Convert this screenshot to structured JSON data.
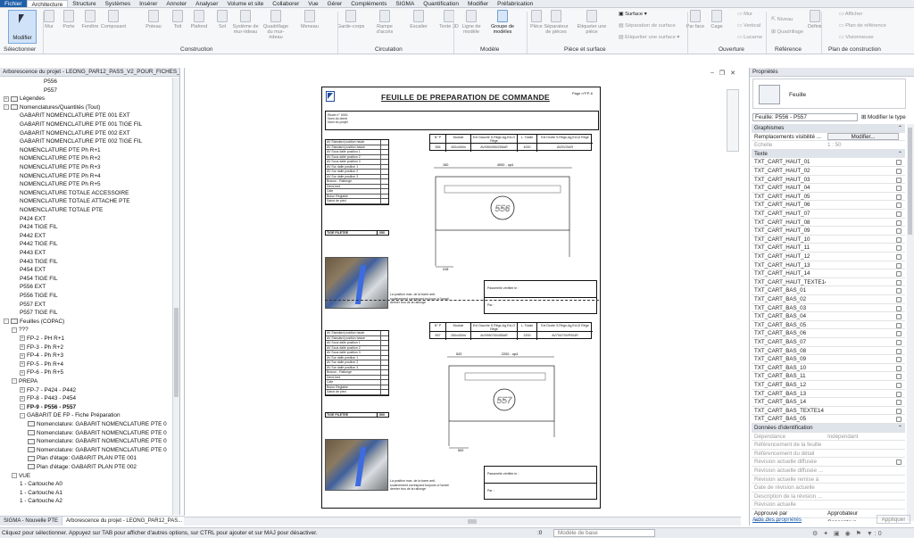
{
  "ribbon_tabs": [
    "Fichier",
    "Architecture",
    "Structure",
    "Systèmes",
    "Insérer",
    "Annoter",
    "Analyser",
    "Volume et site",
    "Collaborer",
    "Vue",
    "Gérer",
    "Compléments",
    "SIGMA",
    "Quantification",
    "Modifier",
    "Préfabrication"
  ],
  "ribbon": {
    "modifier": "Modifier",
    "tools": [
      {
        "label": "Mur"
      },
      {
        "label": "Porte"
      },
      {
        "label": "Fenêtre"
      },
      {
        "label": "Composant"
      },
      {
        "label": "Poteau"
      },
      {
        "label": "Toit"
      },
      {
        "label": "Plafond"
      },
      {
        "label": "Sol"
      },
      {
        "label": "Système de mur-rideau"
      },
      {
        "label": "Quadrillage du mur-rideau"
      },
      {
        "label": "Meneau"
      },
      {
        "label": "Garde-corps"
      },
      {
        "label": "Rampe d'accès"
      },
      {
        "label": "Escalier"
      },
      {
        "label": "Texte 3D"
      },
      {
        "label": "Ligne de modèle"
      },
      {
        "label": "Groupe de modèles"
      },
      {
        "label": "Pièce"
      },
      {
        "label": "Séparateur de pièces"
      },
      {
        "label": "Etiqueter une pièce"
      },
      {
        "label": "Par face"
      },
      {
        "label": "Cage"
      },
      {
        "label": "Définir"
      }
    ],
    "surface": "Surface",
    "sep_surface": "Séparation de surface",
    "etiq_surface": "Etiquetter une surface",
    "mur": "Mur",
    "vertical": "Vertical",
    "lucarne": "Lucarne",
    "niveau": "Niveau",
    "quadrillage": "Quadrillage",
    "afficher": "Afficher",
    "plan_ref": "Plan de référence",
    "visionneuse": "Visionneuse",
    "groups": [
      "Sélectionner",
      "Construction",
      "Circulation",
      "Modèle",
      "Pièce et surface",
      "Ouverture",
      "Référence",
      "Plan de construction"
    ]
  },
  "browser": {
    "title": "Arborescence du projet - LEONG_PAR12_PASS_V2_POUR_FICHES_PRE...",
    "items": [
      {
        "text": "P556",
        "lvl": 5,
        "toggle": ""
      },
      {
        "text": "P557",
        "lvl": 5,
        "toggle": ""
      },
      {
        "text": "Légendes",
        "lvl": 0,
        "toggle": "+",
        "icon": true
      },
      {
        "text": "Nomenclatures/Quantités (Tout)",
        "lvl": 0,
        "toggle": "-",
        "icon": true
      },
      {
        "text": "GABARIT NOMENCLATURE PTE 001 EXT",
        "lvl": 2,
        "toggle": ""
      },
      {
        "text": "GABARIT NOMENCLATURE PTE 001 TIGE FIL",
        "lvl": 2,
        "toggle": ""
      },
      {
        "text": "GABARIT NOMENCLATURE PTE 002 EXT",
        "lvl": 2,
        "toggle": ""
      },
      {
        "text": "GABARIT NOMENCLATURE PTE 002 TIGE FIL",
        "lvl": 2,
        "toggle": ""
      },
      {
        "text": "NOMENCLATURE PTE Ph R+1",
        "lvl": 2,
        "toggle": ""
      },
      {
        "text": "NOMENCLATURE PTE Ph R+2",
        "lvl": 2,
        "toggle": ""
      },
      {
        "text": "NOMENCLATURE PTE Ph R+3",
        "lvl": 2,
        "toggle": ""
      },
      {
        "text": "NOMENCLATURE PTE Ph R+4",
        "lvl": 2,
        "toggle": ""
      },
      {
        "text": "NOMENCLATURE PTE Ph R+5",
        "lvl": 2,
        "toggle": ""
      },
      {
        "text": "NOMENCLATURE TOTALE ACCESSOIRE",
        "lvl": 2,
        "toggle": ""
      },
      {
        "text": "NOMENCLATURE TOTALE ATTACHE PTE",
        "lvl": 2,
        "toggle": ""
      },
      {
        "text": "NOMENCLATURE TOTALE PTE",
        "lvl": 2,
        "toggle": ""
      },
      {
        "text": "P424 EXT",
        "lvl": 2,
        "toggle": ""
      },
      {
        "text": "P424 TIGE FIL",
        "lvl": 2,
        "toggle": ""
      },
      {
        "text": "P442 EXT",
        "lvl": 2,
        "toggle": ""
      },
      {
        "text": "P442 TIGE FIL",
        "lvl": 2,
        "toggle": ""
      },
      {
        "text": "P443 EXT",
        "lvl": 2,
        "toggle": ""
      },
      {
        "text": "P443 TIGE FIL",
        "lvl": 2,
        "toggle": ""
      },
      {
        "text": "P454 EXT",
        "lvl": 2,
        "toggle": ""
      },
      {
        "text": "P454 TIGE FIL",
        "lvl": 2,
        "toggle": ""
      },
      {
        "text": "P556 EXT",
        "lvl": 2,
        "toggle": ""
      },
      {
        "text": "P556 TIGE FIL",
        "lvl": 2,
        "toggle": ""
      },
      {
        "text": "P557 EXT",
        "lvl": 2,
        "toggle": ""
      },
      {
        "text": "P557 TIGE FIL",
        "lvl": 2,
        "toggle": ""
      },
      {
        "text": "Feuilles (COPAC)",
        "lvl": 0,
        "toggle": "-",
        "icon": true
      },
      {
        "text": "???",
        "lvl": 1,
        "toggle": "-"
      },
      {
        "text": "FP-2 - PH R+1",
        "lvl": 2,
        "toggle": "+"
      },
      {
        "text": "FP-3 - Ph R+2",
        "lvl": 2,
        "toggle": "+"
      },
      {
        "text": "FP-4 - Ph R+3",
        "lvl": 2,
        "toggle": "+"
      },
      {
        "text": "FP-5 - Ph R+4",
        "lvl": 2,
        "toggle": "+"
      },
      {
        "text": "FP-6 - Ph R+5",
        "lvl": 2,
        "toggle": "+"
      },
      {
        "text": "PREPA",
        "lvl": 1,
        "toggle": "-"
      },
      {
        "text": "FP-7 - P424 - P442",
        "lvl": 2,
        "toggle": "+"
      },
      {
        "text": "FP-8 - P443 - P454",
        "lvl": 2,
        "toggle": "+"
      },
      {
        "text": "FP-9 - P556 - P557",
        "lvl": 2,
        "toggle": "-",
        "bold": true
      },
      {
        "text": "GABARIT DE FP - Fiche Préparation",
        "lvl": 2,
        "toggle": "-"
      },
      {
        "text": "Nomenclature: GABARIT NOMENCLATURE PTE 0",
        "lvl": 3,
        "toggle": "",
        "icon": true
      },
      {
        "text": "Nomenclature: GABARIT NOMENCLATURE PTE 0",
        "lvl": 3,
        "toggle": "",
        "icon": true
      },
      {
        "text": "Nomenclature: GABARIT NOMENCLATURE PTE 0",
        "lvl": 3,
        "toggle": "",
        "icon": true
      },
      {
        "text": "Nomenclature: GABARIT NOMENCLATURE PTE 0",
        "lvl": 3,
        "toggle": "",
        "icon": true
      },
      {
        "text": "Plan d'étage: GABARIT PLAN PTE 001",
        "lvl": 3,
        "toggle": "",
        "icon": true
      },
      {
        "text": "Plan d'étage: GABARIT PLAN PTE 002",
        "lvl": 3,
        "toggle": "",
        "icon": true
      },
      {
        "text": "VUE",
        "lvl": 1,
        "toggle": "-"
      },
      {
        "text": "1 - Cartouche A0",
        "lvl": 2,
        "toggle": ""
      },
      {
        "text": "1 - Cartouche A1",
        "lvl": 2,
        "toggle": ""
      },
      {
        "text": "1 - Cartouche A2",
        "lvl": 2,
        "toggle": ""
      }
    ]
  },
  "bottom_tabs": [
    "SIGMA - Nouvelle PTE",
    "Arborescence du projet - LEONG_PAR12_PAS..."
  ],
  "sheet": {
    "title": "FEUILLE DE PREPARATION DE COMMANDE",
    "page": "Page n°FP-6",
    "header_lines": [
      "Etude n° 0001",
      "Nom du client",
      "Nom du projet"
    ],
    "left_rows": [
      "AV Standard position haute",
      "AV Standard position basse",
      "AV Sous dalle position 1",
      "AV Sous dalle position 2",
      "AV Sous dalle position 3",
      "AV Sur dalle position 1",
      "AV Sur dalle position 2",
      "AV Sur dalle position 3",
      "Bracon - Rallonge",
      "Demi-bed",
      "Cale",
      "Buton Reglable",
      "Sabot de pied"
    ],
    "tige": "TIGE FILETEE",
    "tige_values": [
      "050",
      "500"
    ],
    "table_headers": [
      "N° P",
      "Module",
      "Ext Gauche S.Rêge,Ag,Ext,G Rêge",
      "L. Totale",
      "Ext Droite S.Rêge,Ag,Ext,D Rêge"
    ],
    "rows": [
      [
        "556",
        "400x400m",
        "AV/050/050/255AR",
        "4000",
        "AVDV/DAR"
      ],
      [
        "557",
        "250x400m",
        "AV/095/700/455AR",
        "2200",
        "AV700/700/P004R"
      ]
    ],
    "note": "La position max. de la barre anti-soulevement correspond toujours à l'avant dernier trou de la rallonge",
    "box_labels": [
      "Passerelle vérifiée le :",
      "Par :"
    ],
    "marks": [
      "556",
      "557"
    ],
    "dims": [
      "4000 - up4",
      "2200 - up4",
      "150",
      "520",
      "418",
      "500"
    ]
  },
  "properties": {
    "title": "Propriétés",
    "type_name": "Feuille",
    "selector": "Feuille: P556 - P557",
    "modify_type": "Modifier le type",
    "rows": [
      {
        "k": "Graphismes",
        "cat": true
      },
      {
        "k": "Remplacements visibilité ...",
        "btn": "Modifier..."
      },
      {
        "k": "Echelle",
        "v": "1 : 50",
        "gray": true
      },
      {
        "k": "Texte",
        "cat": true
      },
      {
        "k": "TXT_CART_HAUT_01",
        "cb": true
      },
      {
        "k": "TXT_CART_HAUT_02",
        "cb": true
      },
      {
        "k": "TXT_CART_HAUT_03",
        "cb": true
      },
      {
        "k": "TXT_CART_HAUT_04",
        "cb": true
      },
      {
        "k": "TXT_CART_HAUT_05",
        "cb": true
      },
      {
        "k": "TXT_CART_HAUT_06",
        "cb": true
      },
      {
        "k": "TXT_CART_HAUT_07",
        "cb": true
      },
      {
        "k": "TXT_CART_HAUT_08",
        "cb": true
      },
      {
        "k": "TXT_CART_HAUT_09",
        "cb": true
      },
      {
        "k": "TXT_CART_HAUT_10",
        "cb": true
      },
      {
        "k": "TXT_CART_HAUT_11",
        "cb": true
      },
      {
        "k": "TXT_CART_HAUT_12",
        "cb": true
      },
      {
        "k": "TXT_CART_HAUT_13",
        "cb": true
      },
      {
        "k": "TXT_CART_HAUT_14",
        "cb": true
      },
      {
        "k": "TXT_CART_HAUT_TEXTE14",
        "cb": true
      },
      {
        "k": "TXT_CART_BAS_01",
        "cb": true
      },
      {
        "k": "TXT_CART_BAS_02",
        "cb": true
      },
      {
        "k": "TXT_CART_BAS_03",
        "cb": true
      },
      {
        "k": "TXT_CART_BAS_04",
        "cb": true
      },
      {
        "k": "TXT_CART_BAS_05",
        "cb": true
      },
      {
        "k": "TXT_CART_BAS_06",
        "cb": true
      },
      {
        "k": "TXT_CART_BAS_07",
        "cb": true
      },
      {
        "k": "TXT_CART_BAS_08",
        "cb": true
      },
      {
        "k": "TXT_CART_BAS_09",
        "cb": true
      },
      {
        "k": "TXT_CART_BAS_10",
        "cb": true
      },
      {
        "k": "TXT_CART_BAS_11",
        "cb": true
      },
      {
        "k": "TXT_CART_BAS_12",
        "cb": true
      },
      {
        "k": "TXT_CART_BAS_13",
        "cb": true
      },
      {
        "k": "TXT_CART_BAS_14",
        "cb": true
      },
      {
        "k": "TXT_CART_BAS_TEXTE14",
        "cb": true
      },
      {
        "k": "TXT_CART_BAS_05",
        "cb": true
      },
      {
        "k": "Données d'identification",
        "cat": true
      },
      {
        "k": "Dépendance",
        "v": "Indépendant",
        "gray": true
      },
      {
        "k": "Référencement de la feuille",
        "gray": true
      },
      {
        "k": "Référencement du détail",
        "gray": true
      },
      {
        "k": "Révision actuelle diffusée",
        "gray": true,
        "cb": true
      },
      {
        "k": "Révision actuelle diffusée ...",
        "gray": true
      },
      {
        "k": "Révision actuelle remise à",
        "gray": true
      },
      {
        "k": "Date de révision actuelle",
        "gray": true
      },
      {
        "k": "Description de la révision ...",
        "gray": true
      },
      {
        "k": "Révision actuelle",
        "gray": true
      },
      {
        "k": "Approuvé par",
        "v": "Approbateur"
      },
      {
        "k": "Conçu par",
        "v": "Concepteur"
      }
    ],
    "help": "Aide des propriétés",
    "apply": "Appliquer"
  },
  "status": {
    "message": "Cliquez pour sélectionner. Appuyez sur TAB pour afficher d'autres options, sur CTRL pour ajouter et sur MAJ pour désactiver.",
    "zero": ":0",
    "model": "Modèle de base"
  }
}
